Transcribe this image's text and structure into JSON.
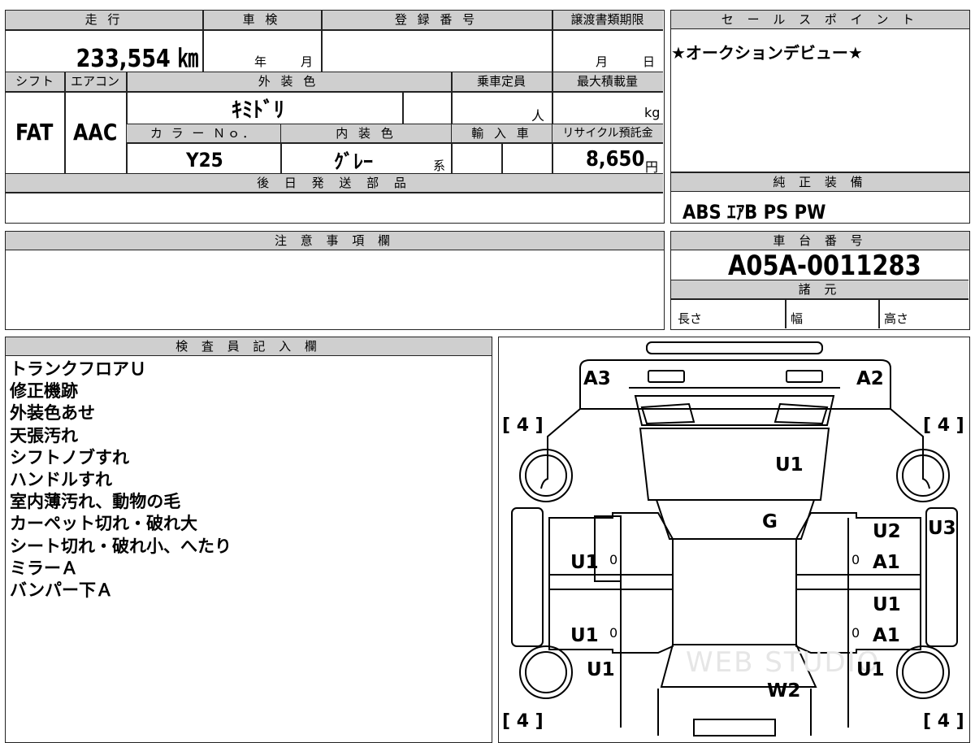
{
  "top_info": {
    "mileage_label": "走 行",
    "mileage_value": "233,554 ㎞",
    "shaken_label": "車 検",
    "shaken_year": "年",
    "shaken_month": "月",
    "reg_label": "登 録 番 号",
    "deadline_label": "譲渡書類期限",
    "deadline_month": "月",
    "deadline_day": "日",
    "shift_label": "シフト",
    "shift_value": "FAT",
    "ac_label": "エアコン",
    "ac_value": "AAC",
    "exterior_label": "外 装 色",
    "exterior_value": "ｷﾐﾄﾞﾘ",
    "capacity_label": "乗車定員",
    "capacity_unit": "人",
    "maxload_label": "最大積載量",
    "maxload_unit": "kg",
    "color_no_label": "カ ラ ー Ｎｏ．",
    "color_no_value": "Y25",
    "interior_label": "内 装 色",
    "interior_value": "ｸﾞﾚｰ",
    "interior_suffix": "系",
    "import_label": "輸 入 車",
    "recycle_label": "リサイクル預託金",
    "recycle_value": "8,650",
    "recycle_unit": "円",
    "later_parts_label": "後 日 発 送 部 品"
  },
  "sales_point": {
    "label": "セ ー ル ス ポ イ ン ト",
    "text": "★オークションデビュー★"
  },
  "equipment": {
    "label": "純 正 装 備",
    "text": "ABS ｴｱB PS PW"
  },
  "caution": {
    "label": "注 意 事 項 欄"
  },
  "chassis": {
    "label": "車 台 番 号",
    "value": "A05A-0011283",
    "specs_label": "諸 元",
    "length_label": "長さ",
    "width_label": "幅",
    "height_label": "高さ"
  },
  "inspector": {
    "label": "検 査 員 記 入 欄",
    "notes": [
      "トランクフロアＵ",
      "修正機跡",
      "外装色あせ",
      "天張汚れ",
      "シフトノブすれ",
      "ハンドルすれ",
      "室内薄汚れ、動物の毛",
      "カーペット切れ・破れ大",
      "シート切れ・破れ小、へたり",
      "ミラーＡ",
      "バンパー下Ａ"
    ]
  },
  "diagram": {
    "tire_labels": [
      "[ 4 ]",
      "[ 4 ]",
      "[ 4 ]",
      "[ 4 ]"
    ],
    "marks": {
      "a3": "A3",
      "a2": "A2",
      "roof": "U1",
      "g": "G",
      "u2": "U2",
      "u3": "U3",
      "l_front_door": "U1",
      "l_rear_door": "U1",
      "r_front_door": "A1",
      "r_rear_u": "U1",
      "r_rear_a": "A1",
      "l_rear_fender": "U1",
      "r_rear_fender": "U1",
      "w2": "W2",
      "zero1": "0",
      "zero2": "0",
      "zero3": "0",
      "zero4": "0"
    },
    "watermark": "WEB STUDIO"
  }
}
